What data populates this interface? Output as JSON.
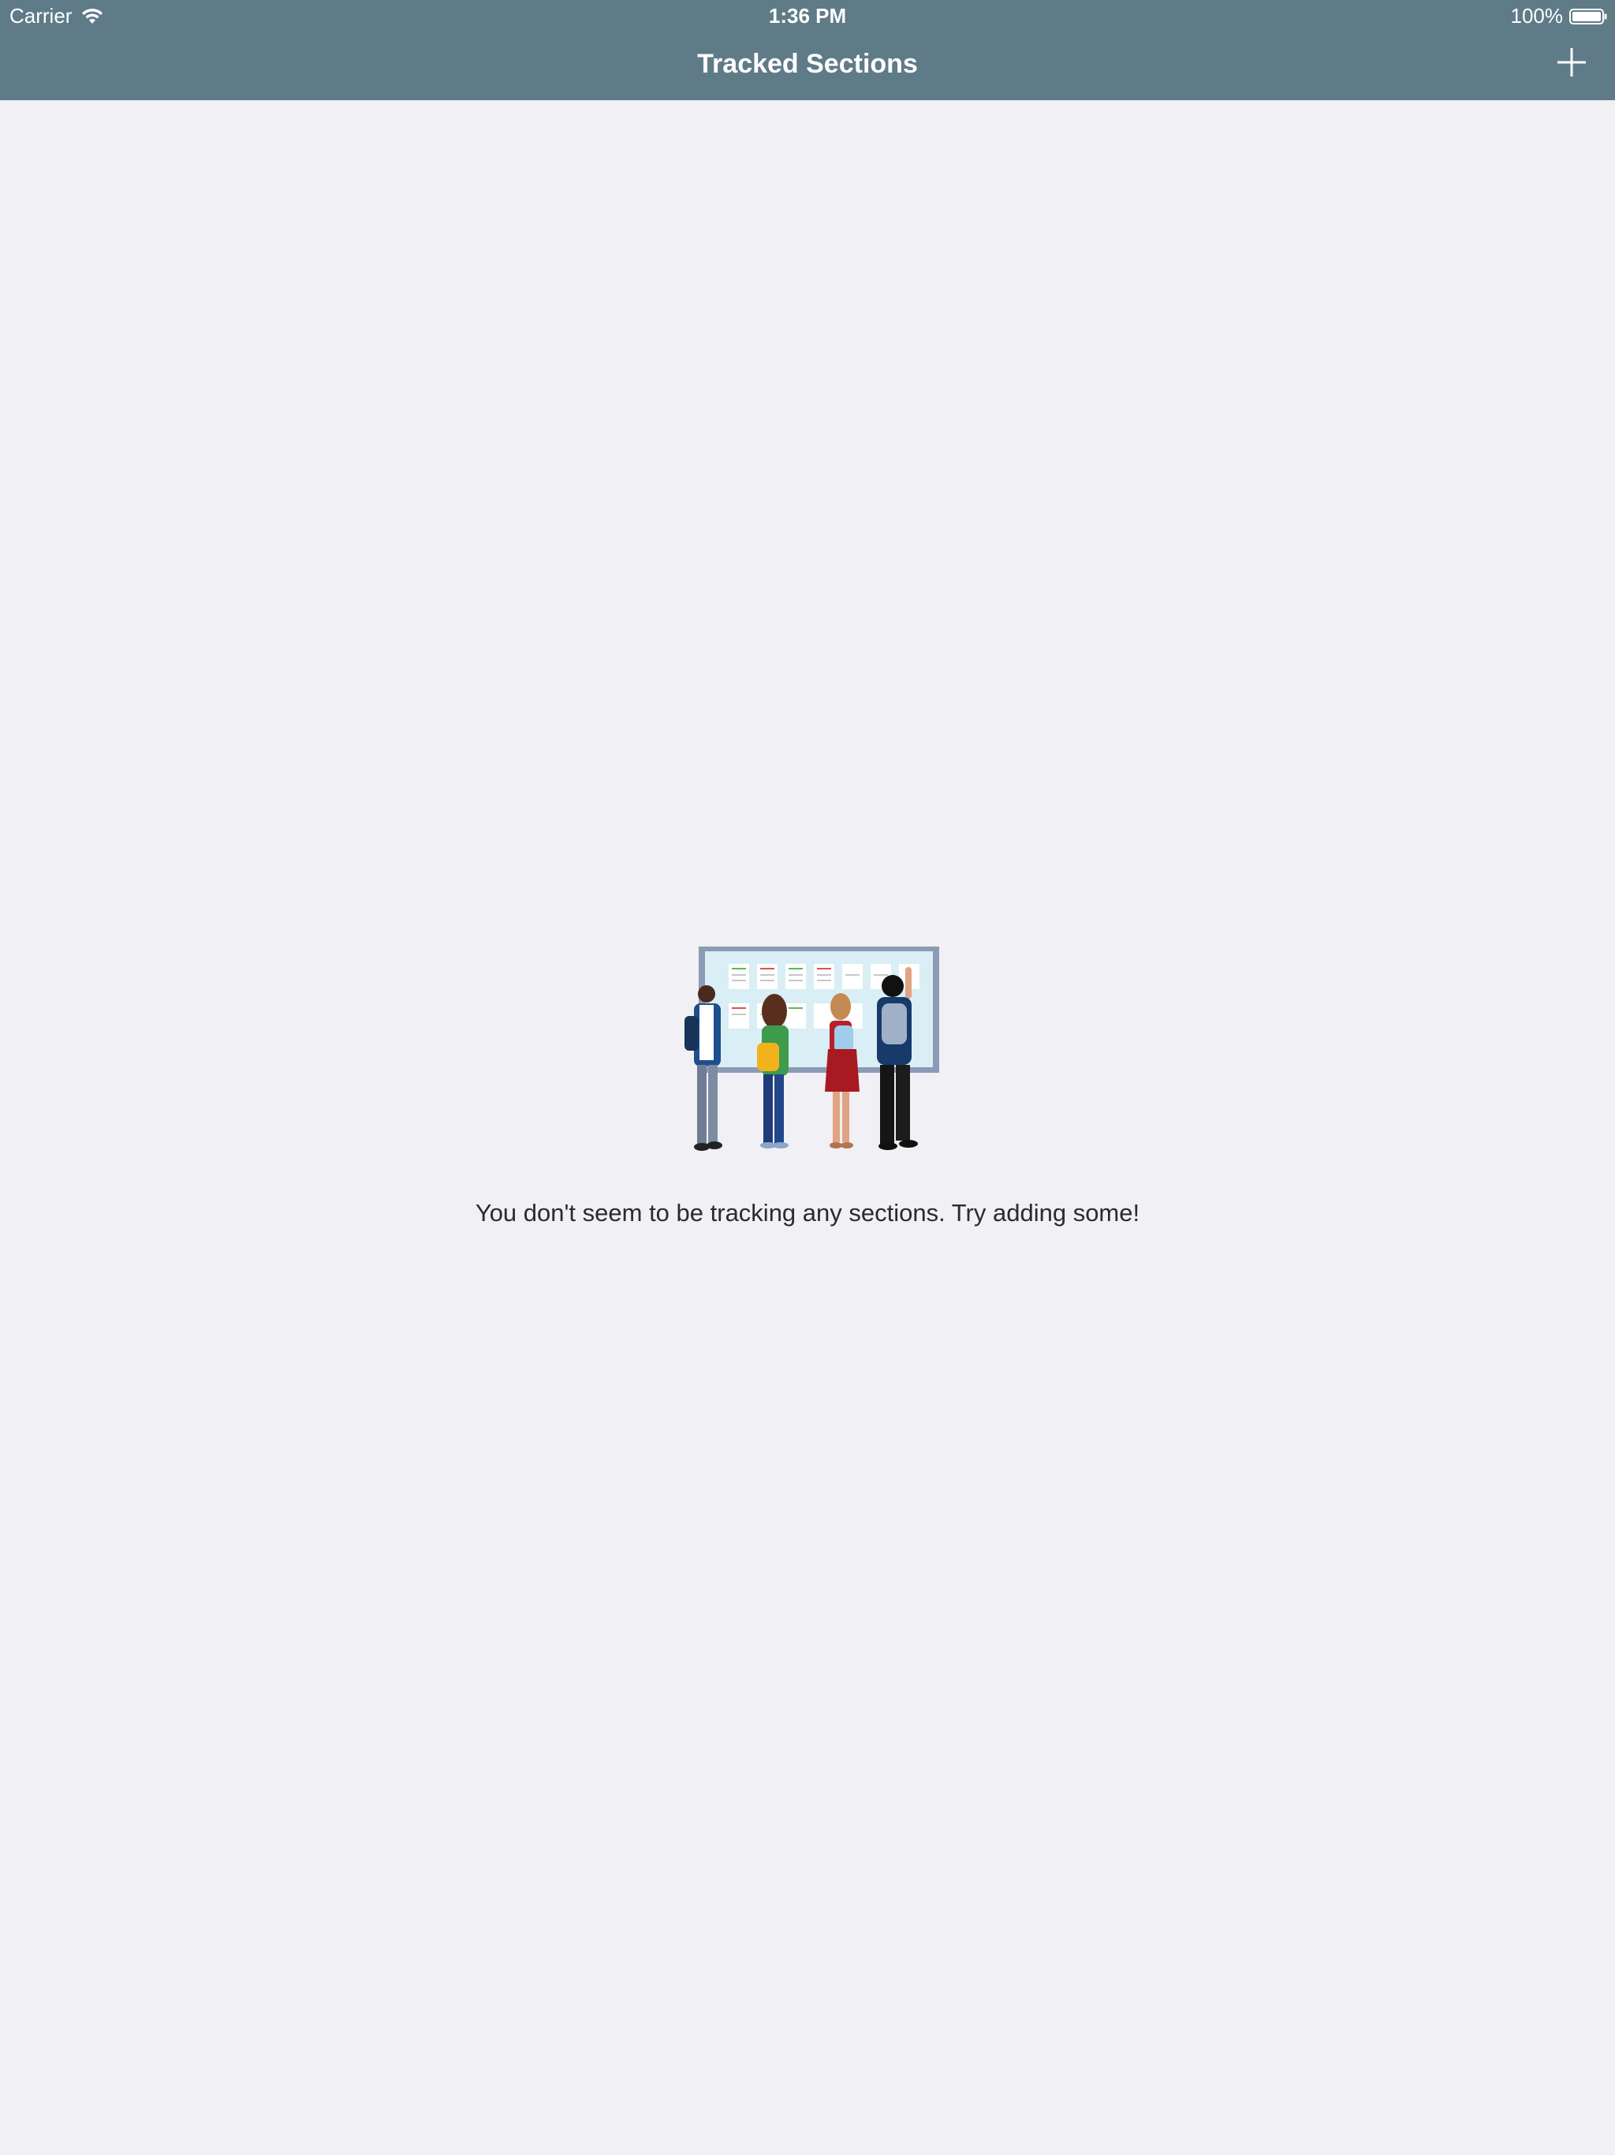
{
  "status_bar": {
    "carrier": "Carrier",
    "time": "1:36 PM",
    "battery": "100%"
  },
  "nav": {
    "title": "Tracked Sections",
    "add_icon": "plus-icon"
  },
  "empty_state": {
    "illustration": "students-at-bulletin-board-illustration",
    "message": "You don't seem to be tracking any sections. Try adding some!"
  },
  "colors": {
    "nav_background": "#5F7B88",
    "page_background": "#F0F0F5",
    "nav_text": "#FFFFFF",
    "body_text": "#2B2B2B"
  }
}
